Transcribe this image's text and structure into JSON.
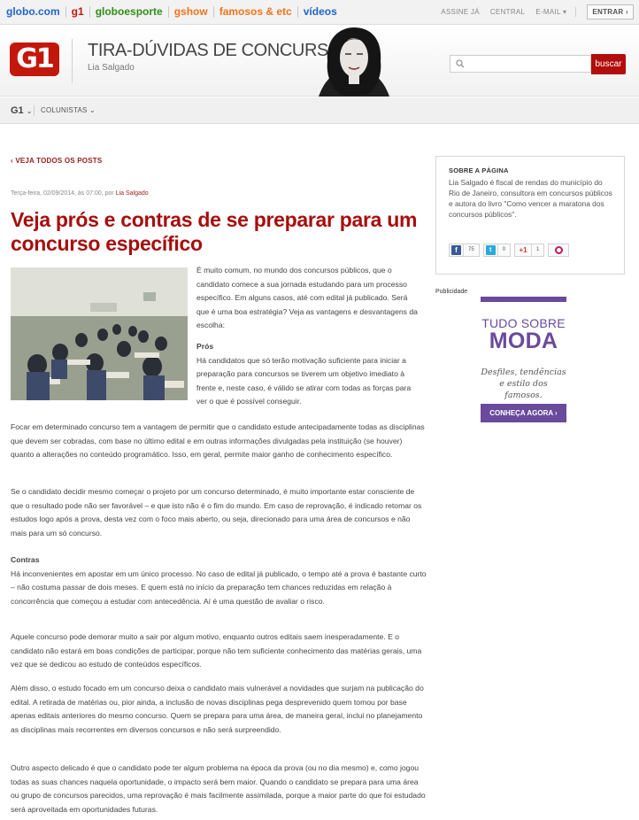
{
  "topbar": {
    "links": [
      {
        "label": "globo.com",
        "color": "#2166c9"
      },
      {
        "label": "g1",
        "color": "#c4170c"
      },
      {
        "label": "globoesporte",
        "color": "#2f8f17"
      },
      {
        "label": "gshow",
        "color": "#f1731c"
      },
      {
        "label": "famosos & etc",
        "color": "#f1731c"
      },
      {
        "label": "vídeos",
        "color": "#2166c9"
      }
    ],
    "assine": "ASSINE JÁ",
    "central": "CENTRAL",
    "email": "E-MAIL",
    "entrar": "ENTRAR"
  },
  "header": {
    "logo": "G1",
    "title": "TIRA-DÚVIDAS DE CONCURSOS",
    "author": "Lia Salgado",
    "search_button": "buscar",
    "search_placeholder": ""
  },
  "subnav": {
    "g1": "G1",
    "colunistas": "COLUNISTAS"
  },
  "article": {
    "back_link": "VEJA TODOS OS POSTS",
    "meta_date": "Terça-feira, 02/09/2014, às 07:00, por",
    "meta_author": "Lia Salgado",
    "headline": "Veja prós e contras de se preparar para um concurso específico",
    "intro": "É muito comum, no mundo dos concursos públicos, que o candidato comece a sua jornada estudando para um processo específico. Em alguns casos, até com edital já publicado. Será que é uma boa estratégia? Veja as vantagens e desvantagens da escolha:",
    "pros_heading": "Prós",
    "pros_text": "Há candidatos que só terão motivação suficiente para iniciar a preparação para concursos se tiverem um objetivo imediato à frente e, neste caso, é válido se atirar com todas as forças para ver o que é possível conseguir.",
    "p1": "Focar em determinado concurso tem a vantagem de permitir que o candidato estude antecipadamente todas as disciplinas que devem ser cobradas, com base no último edital e em outras informações divulgadas pela instituição (se houver) quanto a alterações no conteúdo programático. Isso, em geral, permite maior ganho de conhecimento específico.",
    "p2": "Se o candidato decidir mesmo começar o projeto por um concurso determinado, é muito importante estar consciente de que o resultado pode não ser favorável – e que isto não é o fim do mundo. Em caso de reprovação, é indicado retomar os estudos logo após a prova, desta vez com o foco mais aberto, ou seja, direcionado para uma área de concursos e não mais para um só concurso.",
    "contras_heading": "Contras",
    "contras_text": "Há inconvenientes em apostar em um único processo. No caso de edital já publicado, o tempo até a prova é bastante curto – não costuma passar de dois meses. E quem está no início da preparação tem chances reduzidas em relação à concorrência que começou a estudar com antecedência. Aí é uma questão de avaliar o risco.",
    "p3": "Aquele concurso pode demorar muito a sair por algum motivo, enquanto outros editais saem inesperadamente. E o candidato não estará em boas condições de participar, porque não tem suficiente conhecimento das matérias gerais, uma vez que se dedicou ao estudo de conteúdos específicos.",
    "p4": "Além disso, o estudo focado em um concurso deixa o candidato mais vulnerável a novidades que surjam na publicação do edital. A retirada de matérias ou, pior ainda, a inclusão de novas disciplinas pega desprevenido quem tomou por base apenas editais anteriores do mesmo concurso. Quem se prepara para uma área, de maneira geral, inclui no planejamento as disciplinas mais recorrentes em diversos concursos e não será surpreendido.",
    "p5": "Outro aspecto delicado é que o candidato pode ter algum problema na época da prova (ou no dia mesmo) e, como jogou todas as suas chances naquela oportunidade, o impacto será bem maior. Quando o candidato se prepara para uma área ou grupo de concursos parecidos, uma reprovação é mais facilmente assimilada, porque a maior parte do que foi estudado será aproveitada em oportunidades futuras."
  },
  "sidebar": {
    "title": "SOBRE A PÁGINA",
    "bio": "Lia Salgado é fiscal de rendas do município do Rio de Janeiro, consultora em concursos públicos e autora do livro \"Como vencer a maratona dos concursos públicos\".",
    "share": {
      "facebook_count": "75",
      "twitter_count": "0",
      "gplus_label": "+1",
      "gplus_count": "1"
    },
    "publicidade": "Publicidade",
    "ad": {
      "line1": "TUDO SOBRE",
      "line2": "MODA",
      "line3": "Desfiles, tendências e estilo dos famosos.",
      "cta": "CONHEÇA AGORA ›"
    }
  }
}
